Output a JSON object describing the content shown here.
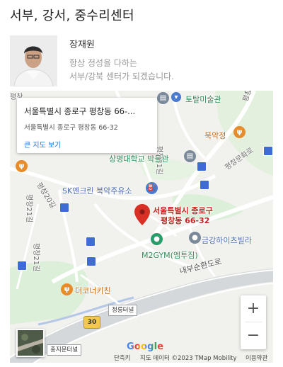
{
  "section": {
    "title": "서부, 강서, 중수리센터"
  },
  "profile": {
    "name": "장재원",
    "desc_line1": "항상 정성을 다하는",
    "desc_line2": "서부/강북 센터가 되겠습니다."
  },
  "map": {
    "info_card": {
      "title": "서울특별시 종로구 평창동 66-...",
      "subtitle": "서울특별시 종로구 평창동 66-32",
      "link": "큰 지도 보기"
    },
    "marker_label_line1": "서울특별시 종로구",
    "marker_label_line2": "평창동 66-32",
    "labels": {
      "totalmuseum": "토탈미술관",
      "bukakjeong": "북악정",
      "sangmyung": "상명대학교 박물관",
      "sk": "SK엔크린 북악주유소",
      "geumgang": "금강하이츠빌라",
      "m2gym": "M2GYM(엠투짐)",
      "naebu": "내부순환도로",
      "corner": "더코너키친",
      "pyeongchang36": "평창36길",
      "pyeongchang31": "평창31길",
      "pyeongchangmunhwa": "평창문화로",
      "pyeongchang20": "평창20길",
      "pyeongchang21": "평창21길",
      "pyeongchang21b": "평창21길",
      "pyeongchang_top": "평창"
    },
    "tags": {
      "jeongreung": "정릉터널",
      "hongji": "홍지문터널"
    },
    "route_shield": "30",
    "zoom_in": "+",
    "zoom_out": "−",
    "google_logo": "Google",
    "attribution": {
      "shortcuts": "단축키",
      "data": "지도 데이터 ©2023 TMap Mobility",
      "terms": "이용약관"
    },
    "colors": {
      "marker": "#d93025",
      "park": "#c8e6c9",
      "road": "#ffffff",
      "highway": "#cfd3d6",
      "link": "#1a73e8"
    }
  }
}
